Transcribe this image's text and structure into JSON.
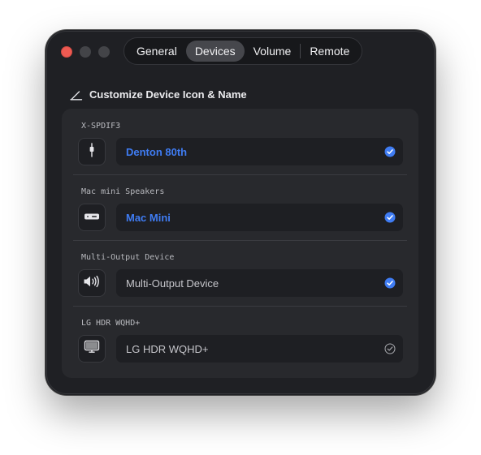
{
  "window": {
    "tabs": [
      {
        "label": "General",
        "active": false
      },
      {
        "label": "Devices",
        "active": true
      },
      {
        "label": "Volume",
        "active": false
      },
      {
        "label": "Remote",
        "active": false
      }
    ]
  },
  "section": {
    "icon": "pencil-icon",
    "title": "Customize Device Icon & Name"
  },
  "devices": [
    {
      "system_name": "X-SPDIF3",
      "display_name": "Denton 80th",
      "customized": true,
      "icon": "plug-icon",
      "checked": true
    },
    {
      "system_name": "Mac mini Speakers",
      "display_name": "Mac Mini",
      "customized": true,
      "icon": "mac-mini-icon",
      "checked": true
    },
    {
      "system_name": "Multi-Output Device",
      "display_name": "Multi-Output Device",
      "customized": false,
      "icon": "speaker-icon",
      "checked": true
    },
    {
      "system_name": "LG HDR WQHD+",
      "display_name": "LG HDR WQHD+",
      "customized": false,
      "icon": "display-icon",
      "checked": false
    }
  ],
  "colors": {
    "accent": "#3f7cf3",
    "window_bg": "#1f2024",
    "panel_bg": "#28292d",
    "close_button": "#ee5a52"
  }
}
